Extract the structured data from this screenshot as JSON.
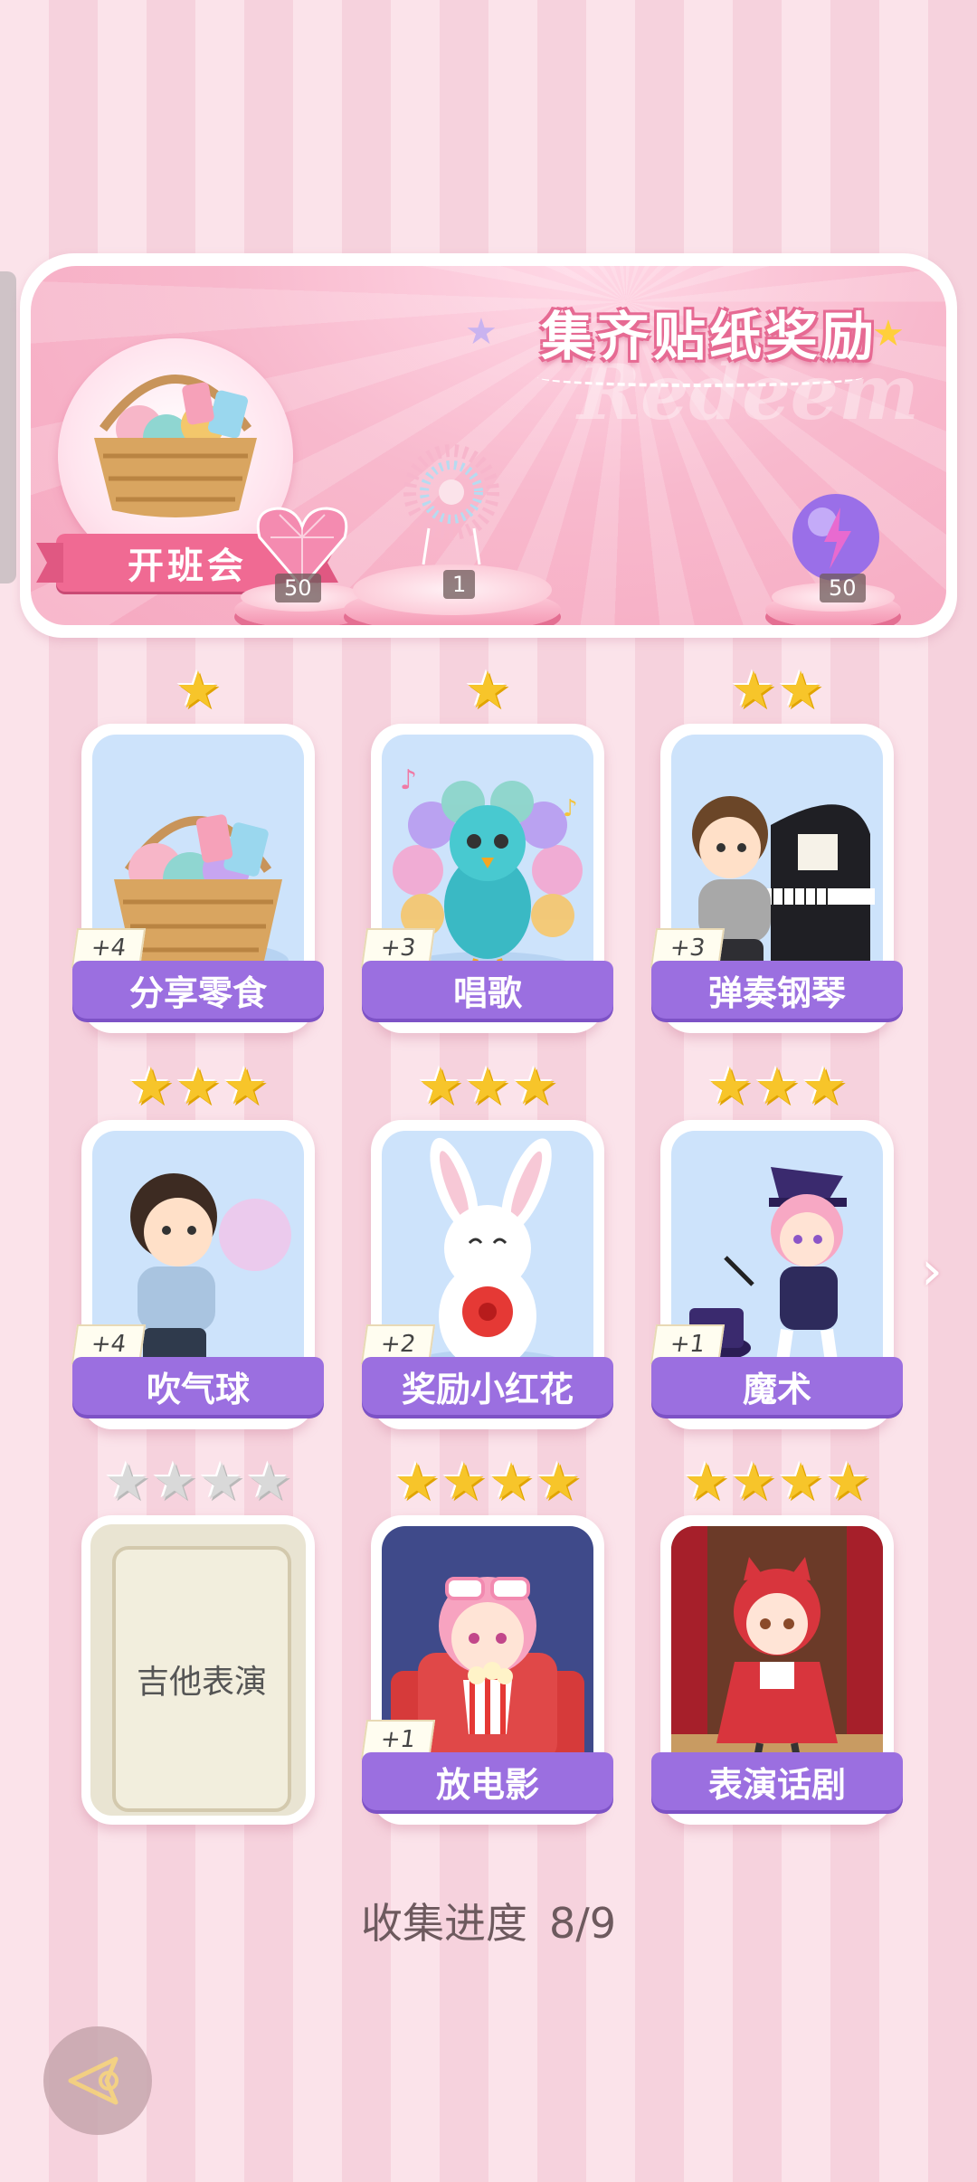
{
  "banner": {
    "title": "集齐贴纸奖励",
    "watermark": "Redeem",
    "event_label": "开班会",
    "rewards": [
      {
        "icon": "pink-heart-gem-icon",
        "count": "50"
      },
      {
        "icon": "pearl-bracelet-icon",
        "count": "1"
      },
      {
        "icon": "purple-energy-orb-icon",
        "count": "50"
      }
    ]
  },
  "cards": [
    {
      "name": "分享零食",
      "stars": 1,
      "bonus": "+4",
      "collected": true
    },
    {
      "name": "唱歌",
      "stars": 1,
      "bonus": "+3",
      "collected": true
    },
    {
      "name": "弹奏钢琴",
      "stars": 2,
      "bonus": "+3",
      "collected": true
    },
    {
      "name": "吹气球",
      "stars": 3,
      "bonus": "+4",
      "collected": true
    },
    {
      "name": "奖励小红花",
      "stars": 3,
      "bonus": "+2",
      "collected": true
    },
    {
      "name": "魔术",
      "stars": 3,
      "bonus": "+1",
      "collected": true
    },
    {
      "name": "吉他表演",
      "stars": 4,
      "bonus": "",
      "collected": false
    },
    {
      "name": "放电影",
      "stars": 4,
      "bonus": "+1",
      "collected": true
    },
    {
      "name": "表演话剧",
      "stars": 4,
      "bonus": "",
      "collected": true
    }
  ],
  "progress": {
    "label": "收集进度",
    "value": "8/9"
  }
}
